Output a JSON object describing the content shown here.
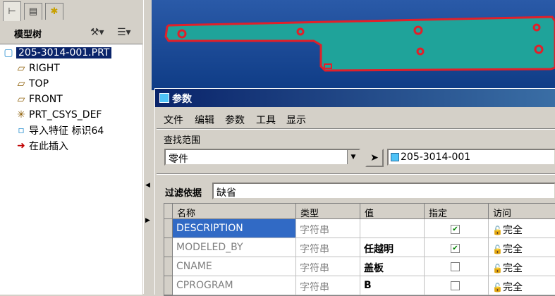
{
  "model_tree": {
    "title": "模型树",
    "items": [
      {
        "label": "205-3014-001.PRT",
        "icon": "part-icon"
      },
      {
        "label": "RIGHT",
        "icon": "datum-plane-icon"
      },
      {
        "label": "TOP",
        "icon": "datum-plane-icon"
      },
      {
        "label": "FRONT",
        "icon": "datum-plane-icon"
      },
      {
        "label": "PRT_CSYS_DEF",
        "icon": "csys-icon"
      },
      {
        "label": "导入特征 标识64",
        "icon": "import-feature-icon"
      },
      {
        "label": "在此插入",
        "icon": "insert-arrow-icon"
      }
    ]
  },
  "dialog": {
    "title": "参数",
    "menu": [
      "文件",
      "编辑",
      "参数",
      "工具",
      "显示"
    ],
    "scope_label": "查找范围",
    "scope_value": "零件",
    "part_value": "205-3014-001",
    "filter_label": "过滤依据",
    "filter_value": "缺省",
    "columns": [
      "名称",
      "类型",
      "值",
      "指定",
      "访问"
    ],
    "rows": [
      {
        "name": "DESCRIPTION",
        "type": "字符串",
        "value": "",
        "designated": true,
        "access": "完全"
      },
      {
        "name": "MODELED_BY",
        "type": "字符串",
        "value": "任越明",
        "designated": true,
        "access": "完全"
      },
      {
        "name": "CNAME",
        "type": "字符串",
        "value": "盖板",
        "designated": false,
        "access": "完全"
      },
      {
        "name": "CPROGRAM",
        "type": "字符串",
        "value": "B",
        "designated": false,
        "access": "完全"
      }
    ]
  },
  "colors": {
    "viewport_bg": "#1b4b96",
    "part_fill": "#1fa39a",
    "part_edge": "#e0202a",
    "selection": "#316ac5"
  }
}
